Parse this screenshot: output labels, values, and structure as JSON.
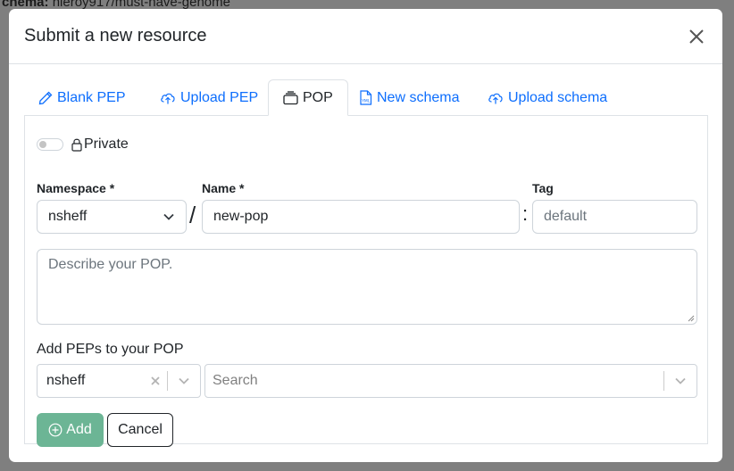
{
  "background": {
    "schema_label": "chema:",
    "schema_value": "nleroy917/must-have-genome"
  },
  "modal": {
    "title": "Submit a new resource",
    "tabs": [
      {
        "label": "Blank PEP",
        "icon": "pencil-icon",
        "active": false
      },
      {
        "label": "Upload PEP",
        "icon": "cloud-upload-icon",
        "active": false
      },
      {
        "label": "POP",
        "icon": "collection-icon",
        "active": true
      },
      {
        "label": "New schema",
        "icon": "yaml-file-icon",
        "active": false
      },
      {
        "label": "Upload schema",
        "icon": "cloud-upload-icon",
        "active": false
      }
    ],
    "private_label": "Private",
    "private_checked": false,
    "namespace": {
      "label": "Namespace *",
      "value": "nsheff"
    },
    "name": {
      "label": "Name *",
      "value": "new-pop"
    },
    "tag": {
      "label": "Tag",
      "placeholder": "default"
    },
    "description_placeholder": "Describe your POP.",
    "add_peps_label": "Add PEPs to your POP",
    "pep_namespace_select": "nsheff",
    "pep_search_placeholder": "Search",
    "add_button": "Add",
    "cancel_button": "Cancel"
  },
  "colors": {
    "link": "#0d6efd",
    "add_button": "#6cb595",
    "overlay": "#7f7f7f"
  }
}
